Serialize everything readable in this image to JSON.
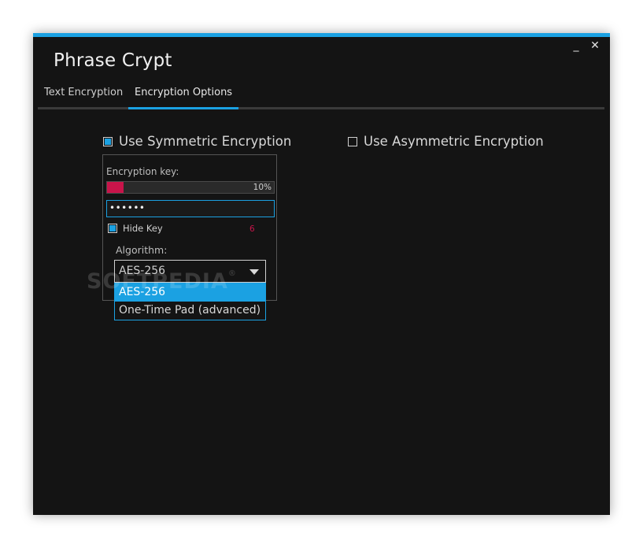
{
  "app": {
    "title": "Phrase Crypt",
    "minimize": "_",
    "close": "✕"
  },
  "tabs": [
    {
      "label": "Text Encryption",
      "active": false
    },
    {
      "label": "Encryption Options",
      "active": true
    }
  ],
  "options": {
    "symmetric": {
      "label": "Use Symmetric Encryption",
      "checked": true
    },
    "asymmetric": {
      "label": "Use Asymmetric Encryption",
      "checked": false
    }
  },
  "key_panel": {
    "key_label": "Encryption key:",
    "strength_percent": 10,
    "strength_text": "10%",
    "password_masked": "••••••",
    "hide_key": {
      "label": "Hide Key",
      "checked": true
    },
    "key_length": "6",
    "algorithm_label": "Algorithm:",
    "algorithm_selected": "AES-256",
    "algorithm_options": [
      "AES-256",
      "One-Time Pad (advanced)"
    ]
  },
  "colors": {
    "accent": "#1ba1e2",
    "strength": "#c8144a",
    "background": "#141414"
  },
  "watermark": {
    "text": "SOFTPEDIA",
    "mark": "®"
  }
}
